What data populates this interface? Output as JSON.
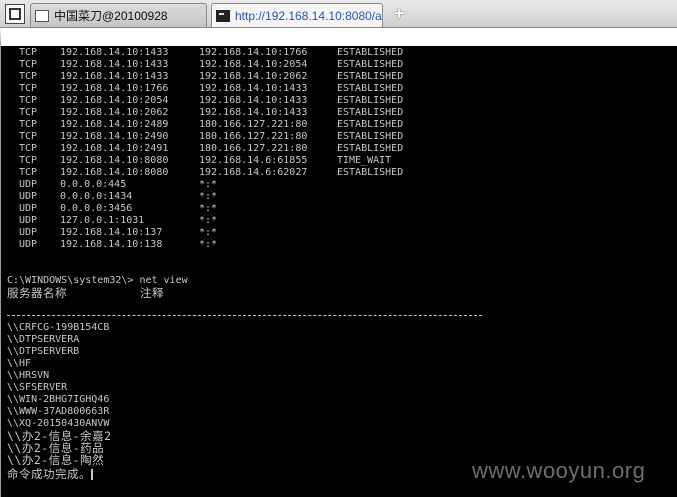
{
  "browser": {
    "tabs": [
      {
        "label": "中国菜刀@20100928",
        "active": false
      },
      {
        "label": "http://192.168.14.10:8080/a...",
        "active": true
      }
    ],
    "new_tab_label": "+"
  },
  "netstat": [
    {
      "proto": "TCP",
      "local": "192.168.14.10:1433",
      "foreign": "192.168.14.10:1766",
      "state": "ESTABLISHED"
    },
    {
      "proto": "TCP",
      "local": "192.168.14.10:1433",
      "foreign": "192.168.14.10:2054",
      "state": "ESTABLISHED"
    },
    {
      "proto": "TCP",
      "local": "192.168.14.10:1433",
      "foreign": "192.168.14.10:2062",
      "state": "ESTABLISHED"
    },
    {
      "proto": "TCP",
      "local": "192.168.14.10:1766",
      "foreign": "192.168.14.10:1433",
      "state": "ESTABLISHED"
    },
    {
      "proto": "TCP",
      "local": "192.168.14.10:2054",
      "foreign": "192.168.14.10:1433",
      "state": "ESTABLISHED"
    },
    {
      "proto": "TCP",
      "local": "192.168.14.10:2062",
      "foreign": "192.168.14.10:1433",
      "state": "ESTABLISHED"
    },
    {
      "proto": "TCP",
      "local": "192.168.14.10:2489",
      "foreign": "180.166.127.221:80",
      "state": "ESTABLISHED"
    },
    {
      "proto": "TCP",
      "local": "192.168.14.10:2490",
      "foreign": "180.166.127.221:80",
      "state": "ESTABLISHED"
    },
    {
      "proto": "TCP",
      "local": "192.168.14.10:2491",
      "foreign": "180.166.127.221:80",
      "state": "ESTABLISHED"
    },
    {
      "proto": "TCP",
      "local": "192.168.14.10:8080",
      "foreign": "192.168.14.6:61855",
      "state": "TIME_WAIT"
    },
    {
      "proto": "TCP",
      "local": "192.168.14.10:8080",
      "foreign": "192.168.14.6:62027",
      "state": "ESTABLISHED"
    },
    {
      "proto": "UDP",
      "local": "0.0.0.0:445",
      "foreign": "*:*",
      "state": ""
    },
    {
      "proto": "UDP",
      "local": "0.0.0.0:1434",
      "foreign": "*:*",
      "state": ""
    },
    {
      "proto": "UDP",
      "local": "0.0.0.0:3456",
      "foreign": "*:*",
      "state": ""
    },
    {
      "proto": "UDP",
      "local": "127.0.0.1:1031",
      "foreign": "*:*",
      "state": ""
    },
    {
      "proto": "UDP",
      "local": "192.168.14.10:137",
      "foreign": "*:*",
      "state": ""
    },
    {
      "proto": "UDP",
      "local": "192.168.14.10:138",
      "foreign": "*:*",
      "state": ""
    }
  ],
  "prompt": "C:\\WINDOWS\\system32\\> net view",
  "header": {
    "server_name": "服务器名称",
    "remark": "注释"
  },
  "servers": [
    "\\\\CRFCG-199B154CB",
    "\\\\DTPSERVERA",
    "\\\\DTPSERVERB",
    "\\\\HF",
    "\\\\HRSVN",
    "\\\\SFSERVER",
    "\\\\WIN-2BHG7IGHQ46",
    "\\\\WWW-37AD800663R",
    "\\\\XQ-20150430ANVW",
    "\\\\办2-信息-余嘉2",
    "\\\\办2-信息-药品",
    "\\\\办2-信息-陶然"
  ],
  "done": "命令成功完成。",
  "watermark": "www.wooyun.org"
}
